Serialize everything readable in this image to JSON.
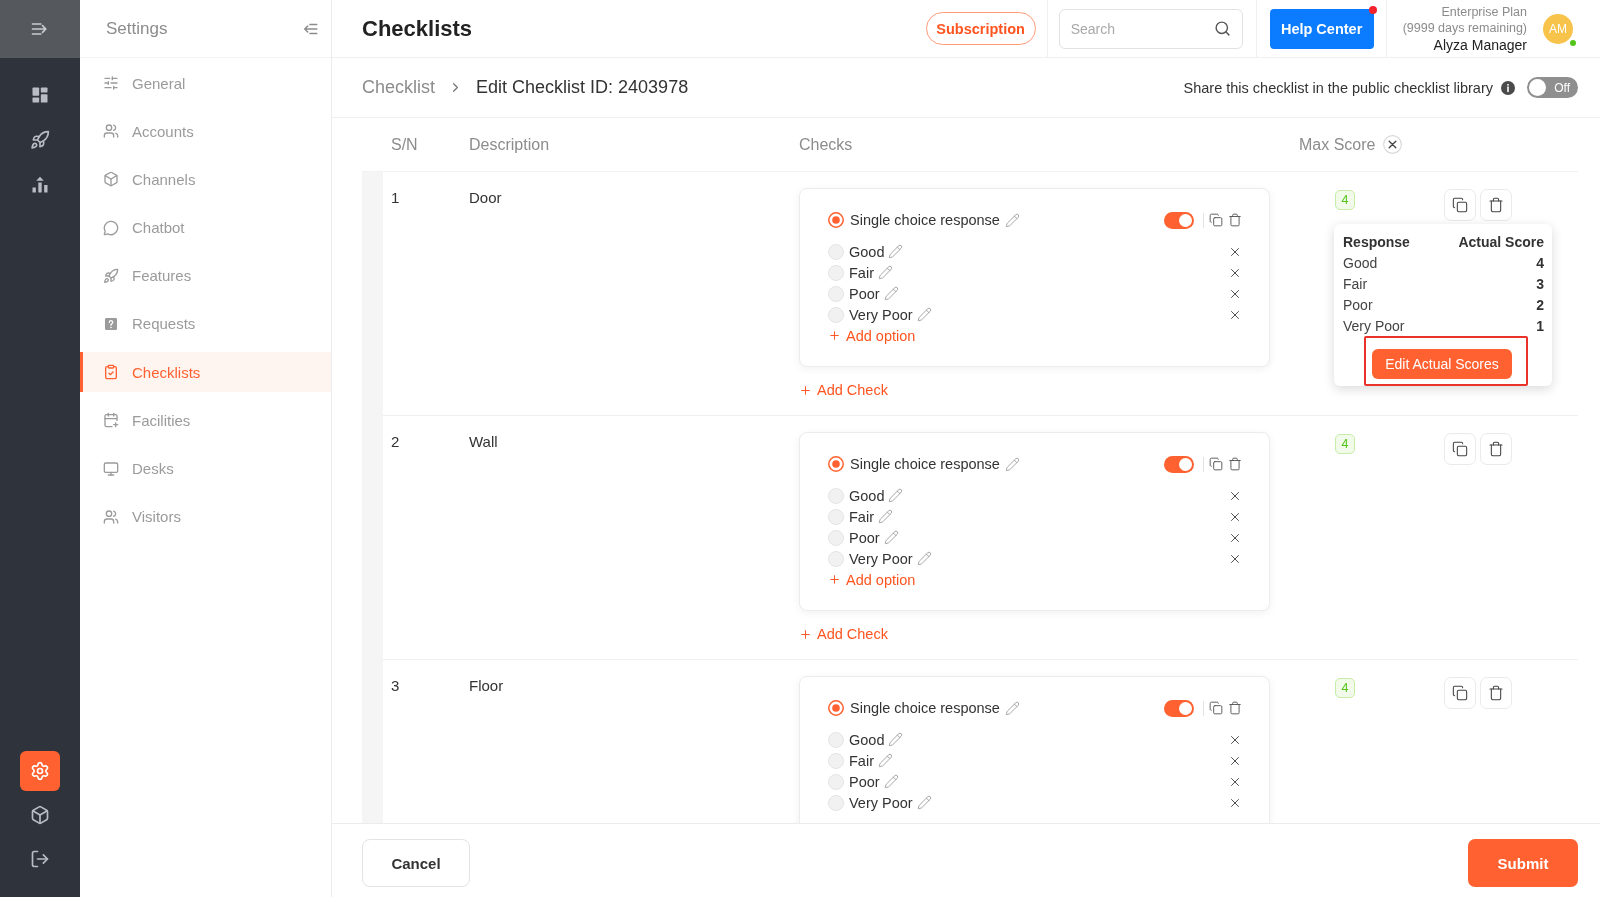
{
  "rail": {
    "items": [
      {
        "selected": false
      },
      {
        "selected": false
      },
      {
        "selected": false
      }
    ],
    "bottom_items": [
      {
        "selected": true
      },
      {
        "selected": false
      },
      {
        "selected": false
      }
    ]
  },
  "settings_menu": {
    "title": "Settings",
    "items": [
      {
        "label": "General",
        "selected": false
      },
      {
        "label": "Accounts",
        "selected": false
      },
      {
        "label": "Channels",
        "selected": false
      },
      {
        "label": "Chatbot",
        "selected": false
      },
      {
        "label": "Features",
        "selected": false
      },
      {
        "label": "Requests",
        "selected": false
      },
      {
        "label": "Checklists",
        "selected": true
      },
      {
        "label": "Facilities",
        "selected": false
      },
      {
        "label": "Desks",
        "selected": false
      },
      {
        "label": "Visitors",
        "selected": false
      }
    ]
  },
  "header": {
    "title": "Checklists",
    "subscription_button": "Subscription",
    "search": {
      "placeholder": "Search"
    },
    "help_button": {
      "label": "Help Center",
      "notification": true
    },
    "account": {
      "plan": "Enterprise Plan",
      "remaining": "(9999 days remaining)",
      "name": "Alyza Manager",
      "initials": "AM",
      "online": true
    }
  },
  "breadcrumb_bar": {
    "breadcrumbs": [
      "Checklist",
      "Edit Checklist ID: 2403978"
    ],
    "share": {
      "label": "Share this checklist in the public checklist library",
      "on": false,
      "toggle_label": "Off"
    }
  },
  "table": {
    "columns": [
      "S/N",
      "Description",
      "Checks",
      "Max Score"
    ],
    "rows": [
      {
        "sn": "1",
        "description": "Door",
        "checks": [
          {
            "type_label": "Single choice response",
            "type_selected": true,
            "enabled": true,
            "options": [
              {
                "label": "Good",
                "selected": false
              },
              {
                "label": "Fair",
                "selected": false
              },
              {
                "label": "Poor",
                "selected": false
              },
              {
                "label": "Very Poor",
                "selected": false
              }
            ],
            "add_option": "Add option"
          }
        ],
        "add_check": "Add Check",
        "max_score": "4",
        "score_popup": {
          "columns": [
            "Response",
            "Actual Score"
          ],
          "rows": [
            {
              "response": "Good",
              "score": "4"
            },
            {
              "response": "Fair",
              "score": "3"
            },
            {
              "response": "Poor",
              "score": "2"
            },
            {
              "response": "Very Poor",
              "score": "1"
            }
          ],
          "button": "Edit Actual Scores",
          "highlighted": true
        }
      },
      {
        "sn": "2",
        "description": "Wall",
        "checks": [
          {
            "type_label": "Single choice response",
            "type_selected": true,
            "enabled": true,
            "options": [
              {
                "label": "Good",
                "selected": false
              },
              {
                "label": "Fair",
                "selected": false
              },
              {
                "label": "Poor",
                "selected": false
              },
              {
                "label": "Very Poor",
                "selected": false
              }
            ],
            "add_option": "Add option"
          }
        ],
        "add_check": "Add Check",
        "max_score": "4"
      },
      {
        "sn": "3",
        "description": "Floor",
        "checks": [
          {
            "type_label": "Single choice response",
            "type_selected": true,
            "enabled": true,
            "options": [
              {
                "label": "Good",
                "selected": false
              },
              {
                "label": "Fair",
                "selected": false
              },
              {
                "label": "Poor",
                "selected": false
              },
              {
                "label": "Very Poor",
                "selected": false
              }
            ]
          }
        ],
        "max_score": "4"
      }
    ]
  },
  "footer": {
    "cancel_button": "Cancel",
    "submit_button": "Submit"
  }
}
